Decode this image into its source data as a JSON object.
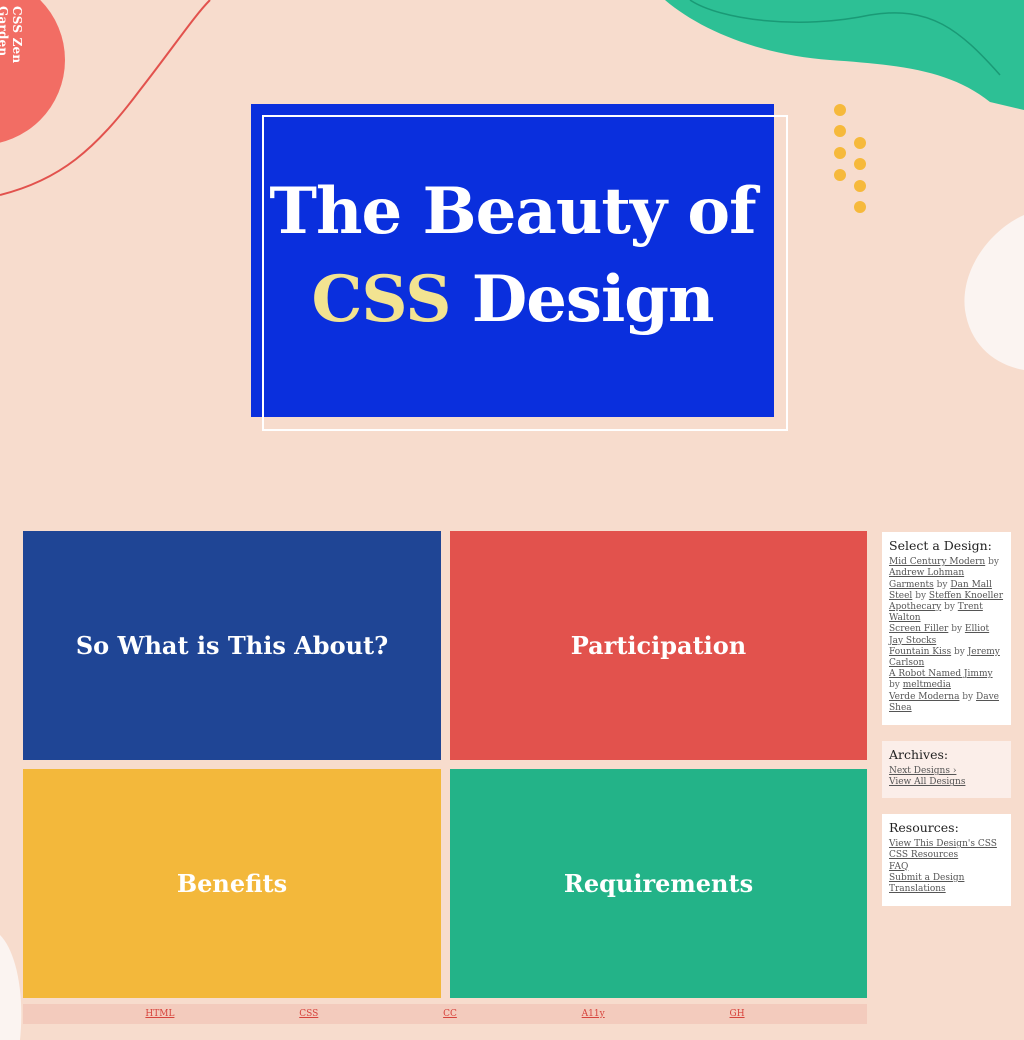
{
  "brand": {
    "vertical_title": "CSS Zen Garden"
  },
  "hero": {
    "title_line1": "The Beauty of",
    "title_accent": "CSS",
    "title_line2_rest": " Design"
  },
  "tiles": [
    {
      "label": "So What is This About?",
      "color": "#1f4595"
    },
    {
      "label": "Participation",
      "color": "#e2524d"
    },
    {
      "label": "Benefits",
      "color": "#f3b83b"
    },
    {
      "label": "Requirements",
      "color": "#23b388"
    }
  ],
  "sidebar": {
    "select": {
      "heading": "Select a Design:",
      "designs": [
        {
          "name": "Mid Century Modern",
          "by": " by ",
          "author": "Andrew Lohman"
        },
        {
          "name": "Garments",
          "by": " by ",
          "author": "Dan Mall"
        },
        {
          "name": "Steel",
          "by": " by ",
          "author": "Steffen Knoeller"
        },
        {
          "name": "Apothecary",
          "by": " by ",
          "author": "Trent Walton"
        },
        {
          "name": "Screen Filler",
          "by": " by ",
          "author": "Elliot Jay Stocks"
        },
        {
          "name": "Fountain Kiss",
          "by": " by ",
          "author": "Jeremy Carlson"
        },
        {
          "name": "A Robot Named Jimmy",
          "by": " by ",
          "author": "meltmedia"
        },
        {
          "name": "Verde Moderna",
          "by": " by ",
          "author": "Dave Shea"
        }
      ]
    },
    "archives": {
      "heading": "Archives:",
      "next": "Next Designs ›",
      "all": "View All Designs"
    },
    "resources": {
      "heading": "Resources:",
      "view_css": "View This Design's CSS",
      "css_resources": "CSS Resources",
      "faq": "FAQ",
      "submit": "Submit a Design",
      "translations": "Translations"
    }
  },
  "footer": {
    "links": [
      "HTML",
      "CSS",
      "CC",
      "A11y",
      "GH"
    ]
  },
  "colors": {
    "background": "#f7dccd",
    "hero_blue": "#0a2fdd",
    "accent_yellow": "#f2e391",
    "dot_yellow": "#f6b93b",
    "shape_green": "#2dc095",
    "shape_coral": "#f26d64"
  }
}
